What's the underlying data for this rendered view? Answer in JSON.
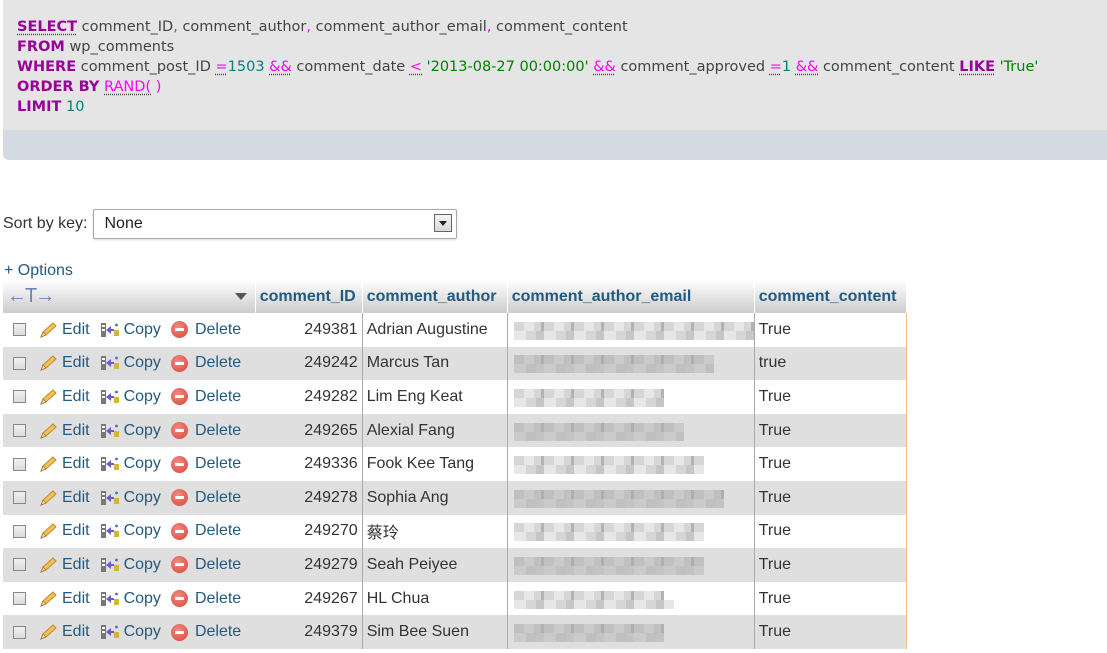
{
  "sql": {
    "line1": {
      "kw": "SELECT",
      "cols": [
        "comment_ID",
        "comment_author",
        "comment_author_email",
        "comment_content"
      ]
    },
    "line2": {
      "kw": "FROM",
      "table": "wp_comments"
    },
    "line3": {
      "kw": "WHERE",
      "c1_col": "comment_post_ID",
      "c1_op": "=",
      "c1_val": "1503",
      "and1": "&&",
      "c2_col": "comment_date",
      "c2_op": "<",
      "c2_val": "'2013-08-27 00:00:00'",
      "and2": "&&",
      "c3_col": "comment_approved",
      "c3_op": "=",
      "c3_val": "1",
      "and3": "&&",
      "c4_col": "comment_content",
      "c4_op": "LIKE",
      "c4_val": "'True'"
    },
    "line4": {
      "kw": "ORDER BY",
      "fn": "RAND(",
      "fn_close": " )"
    },
    "line5": {
      "kw": "LIMIT",
      "val": "10"
    }
  },
  "sort": {
    "label": "Sort by key:",
    "selected": "None"
  },
  "options_link": "+ Options",
  "table": {
    "resize_glyph": "←T→",
    "columns": [
      "comment_ID",
      "comment_author",
      "comment_author_email",
      "comment_content"
    ],
    "actions": {
      "edit": "Edit",
      "copy": "Copy",
      "delete": "Delete"
    },
    "rows": [
      {
        "id": "249381",
        "author": "Adrian Augustine",
        "email": "[blurred]",
        "content": "True"
      },
      {
        "id": "249242",
        "author": "Marcus Tan",
        "email": "[blurred]",
        "content": "true"
      },
      {
        "id": "249282",
        "author": "Lim Eng Keat",
        "email": "[blurred]",
        "content": "True"
      },
      {
        "id": "249265",
        "author": "Alexial Fang",
        "email": "[blurred]",
        "content": "True"
      },
      {
        "id": "249336",
        "author": "Fook Kee Tang",
        "email": "[blurred]",
        "content": "True"
      },
      {
        "id": "249278",
        "author": "Sophia Ang",
        "email": "[blurred]",
        "content": "True"
      },
      {
        "id": "249270",
        "author": "蔡玲",
        "email": "[blurred]",
        "content": "True"
      },
      {
        "id": "249279",
        "author": "Seah Peiyee",
        "email": "[blurred]",
        "content": "True"
      },
      {
        "id": "249267",
        "author": "HL Chua",
        "email": "[blurred]",
        "content": "True"
      },
      {
        "id": "249379",
        "author": "Sim Bee Suen",
        "email": "[blurred]",
        "content": "True"
      }
    ]
  },
  "colors": {
    "link": "#235a81",
    "sql_keyword": "#990099",
    "sql_number": "#008080",
    "sql_string": "#008000",
    "row_alt": "#dfdfdf"
  }
}
